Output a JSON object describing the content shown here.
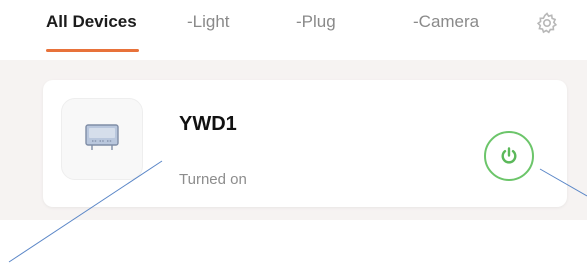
{
  "tabs": [
    {
      "label": "All Devices",
      "active": true
    },
    {
      "label": "-Light",
      "active": false
    },
    {
      "label": "-Plug",
      "active": false
    },
    {
      "label": "-Camera",
      "active": false
    }
  ],
  "settings_icon": "gear-icon",
  "device": {
    "name": "YWD1",
    "status": "Turned on",
    "thumbnail_icon": "heater-panel-icon",
    "power_icon": "power-icon"
  },
  "colors": {
    "accent_underline": "#e8723a",
    "power_green": "#6cc56a",
    "content_background": "#f6f3f2"
  }
}
